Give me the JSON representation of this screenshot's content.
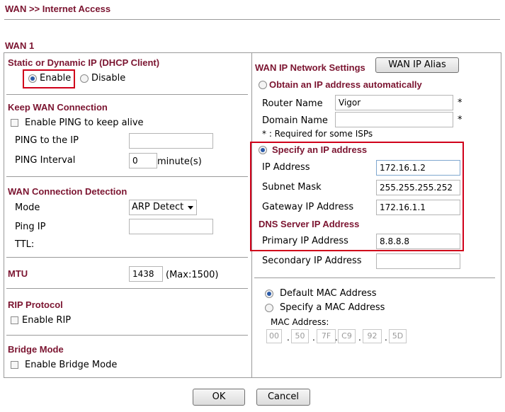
{
  "breadcrumb": "WAN >> Internet Access",
  "section_title": "WAN 1",
  "left": {
    "static_dynamic": {
      "heading": "Static or Dynamic IP (DHCP Client)",
      "enable_label": "Enable",
      "disable_label": "Disable",
      "selected": "Enable"
    },
    "keep_wan": {
      "heading": "Keep WAN Connection",
      "ping_checkbox_label": "Enable PING to keep alive",
      "ping_ip_label": "PING to the IP",
      "ping_ip_value": "",
      "ping_interval_label": "PING Interval",
      "ping_interval_value": "0",
      "ping_interval_unit": "minute(s)"
    },
    "detection": {
      "heading": "WAN Connection Detection",
      "mode_label": "Mode",
      "mode_value": "ARP Detect",
      "ping_ip_label": "Ping IP",
      "ping_ip_value": "",
      "ttl_label": "TTL:"
    },
    "mtu": {
      "heading": "MTU",
      "value": "1438",
      "hint": "(Max:1500)"
    },
    "rip": {
      "heading": "RIP Protocol",
      "checkbox_label": "Enable RIP"
    },
    "bridge": {
      "heading": "Bridge Mode",
      "checkbox_label": "Enable Bridge Mode"
    }
  },
  "right": {
    "heading": "WAN IP Network Settings",
    "alias_button": "WAN IP Alias",
    "obtain_label": "Obtain an IP address automatically",
    "router_name_label": "Router Name",
    "router_name_value": "Vigor",
    "domain_name_label": "Domain Name",
    "domain_name_value": "",
    "required_mark": "*",
    "required_note": "* : Required for some ISPs",
    "specify_label": "Specify an IP address",
    "ip_address_label": "IP Address",
    "ip_address_value": "172.16.1.2",
    "subnet_label": "Subnet Mask",
    "subnet_value": "255.255.255.252",
    "gateway_label": "Gateway IP Address",
    "gateway_value": "172.16.1.1",
    "dns_heading": "DNS Server IP Address",
    "primary_dns_label": "Primary IP Address",
    "primary_dns_value": "8.8.8.8",
    "secondary_dns_label": "Secondary IP Address",
    "secondary_dns_value": "",
    "default_mac_label": "Default MAC Address",
    "specify_mac_label": "Specify a MAC Address",
    "mac_label": "MAC Address:",
    "mac_octets": [
      "00",
      "50",
      "7F",
      "C9",
      "92",
      "5D"
    ],
    "mac_separator": "."
  },
  "actions": {
    "ok_label": "OK",
    "cancel_label": "Cancel"
  },
  "colors": {
    "heading": "#7b1430",
    "highlight_border": "#d0001a",
    "radio_selected": "#2a5aa8"
  }
}
